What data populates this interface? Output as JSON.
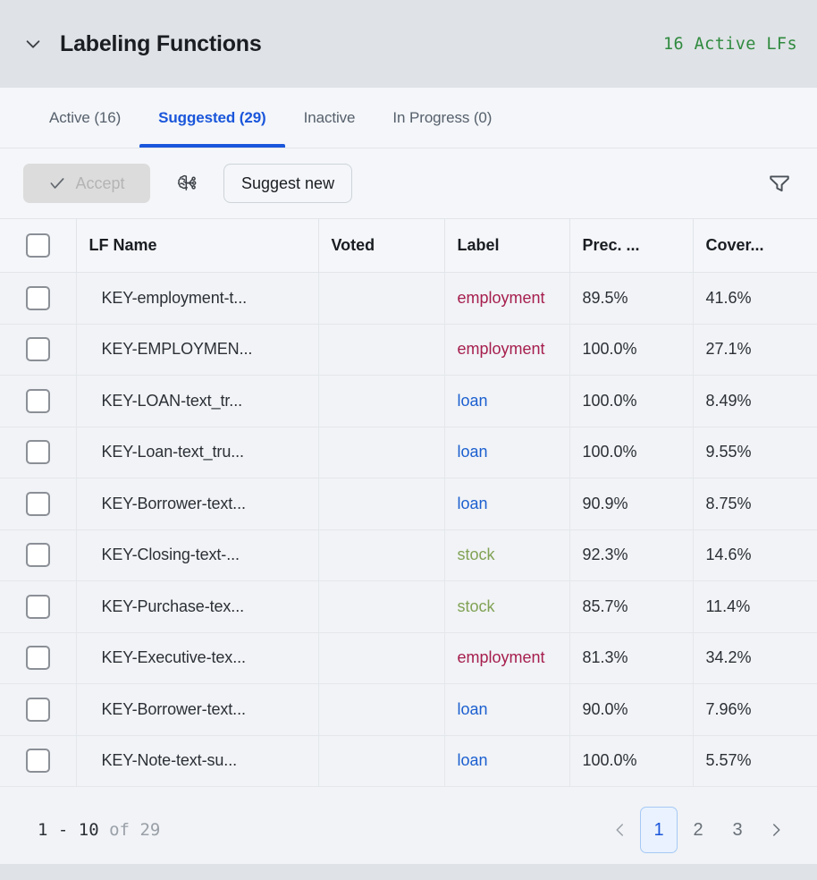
{
  "header": {
    "title": "Labeling Functions",
    "collapse_icon": "chevron-down-icon",
    "active_lfs": "16 Active LFs",
    "active_lfs_color": "#2f8a3f"
  },
  "tabs": [
    {
      "label": "Active (16)",
      "active": false
    },
    {
      "label": "Suggested (29)",
      "active": true
    },
    {
      "label": "Inactive",
      "active": false
    },
    {
      "label": "In Progress (0)",
      "active": false
    }
  ],
  "toolbar": {
    "accept_label": "Accept",
    "accept_icon": "check-icon",
    "accept_disabled": true,
    "ai_icon": "brain-circuit-icon",
    "suggest_new_label": "Suggest new",
    "filter_icon": "funnel-filter-icon"
  },
  "table": {
    "columns": [
      "LF Name",
      "Voted",
      "Label",
      "Prec. ...",
      "Cover..."
    ],
    "select_all_checked": false,
    "rows": [
      {
        "checked": false,
        "name": "KEY-employment-t...",
        "voted": "",
        "label": "employment",
        "label_kind": "employment",
        "precision": "89.5%",
        "precision_high": false,
        "coverage": "41.6%"
      },
      {
        "checked": false,
        "name": "KEY-EMPLOYMEN...",
        "voted": "",
        "label": "employment",
        "label_kind": "employment",
        "precision": "100.0%",
        "precision_high": true,
        "coverage": "27.1%"
      },
      {
        "checked": false,
        "name": "KEY-LOAN-text_tr...",
        "voted": "",
        "label": "loan",
        "label_kind": "loan",
        "precision": "100.0%",
        "precision_high": true,
        "coverage": "8.49%"
      },
      {
        "checked": false,
        "name": "KEY-Loan-text_tru...",
        "voted": "",
        "label": "loan",
        "label_kind": "loan",
        "precision": "100.0%",
        "precision_high": true,
        "coverage": "9.55%"
      },
      {
        "checked": false,
        "name": "KEY-Borrower-text...",
        "voted": "",
        "label": "loan",
        "label_kind": "loan",
        "precision": "90.9%",
        "precision_high": true,
        "coverage": "8.75%"
      },
      {
        "checked": false,
        "name": "KEY-Closing-text-...",
        "voted": "",
        "label": "stock",
        "label_kind": "stock",
        "precision": "92.3%",
        "precision_high": true,
        "coverage": "14.6%"
      },
      {
        "checked": false,
        "name": "KEY-Purchase-tex...",
        "voted": "",
        "label": "stock",
        "label_kind": "stock",
        "precision": "85.7%",
        "precision_high": false,
        "coverage": "11.4%"
      },
      {
        "checked": false,
        "name": "KEY-Executive-tex...",
        "voted": "",
        "label": "employment",
        "label_kind": "employment",
        "precision": "81.3%",
        "precision_high": false,
        "coverage": "34.2%"
      },
      {
        "checked": false,
        "name": "KEY-Borrower-text...",
        "voted": "",
        "label": "loan",
        "label_kind": "loan",
        "precision": "90.0%",
        "precision_high": false,
        "coverage": "7.96%"
      },
      {
        "checked": false,
        "name": "KEY-Note-text-su...",
        "voted": "",
        "label": "loan",
        "label_kind": "loan",
        "precision": "100.0%",
        "precision_high": true,
        "coverage": "5.57%"
      }
    ]
  },
  "pagination": {
    "range_from": "1 - 10",
    "range_of": "of",
    "range_total": "29",
    "prev_icon": "chevron-left-icon",
    "next_icon": "chevron-right-icon",
    "pages": [
      "1",
      "2",
      "3"
    ],
    "current_page": "1"
  },
  "colors": {
    "accent_blue": "#1a56db",
    "label_employment": "#a61e4d",
    "label_loan": "#1c5fd0",
    "label_stock": "#81a255",
    "precision_high": "#40a45b",
    "header_bg": "#dfe2e6",
    "body_bg": "#f1f3f6"
  }
}
